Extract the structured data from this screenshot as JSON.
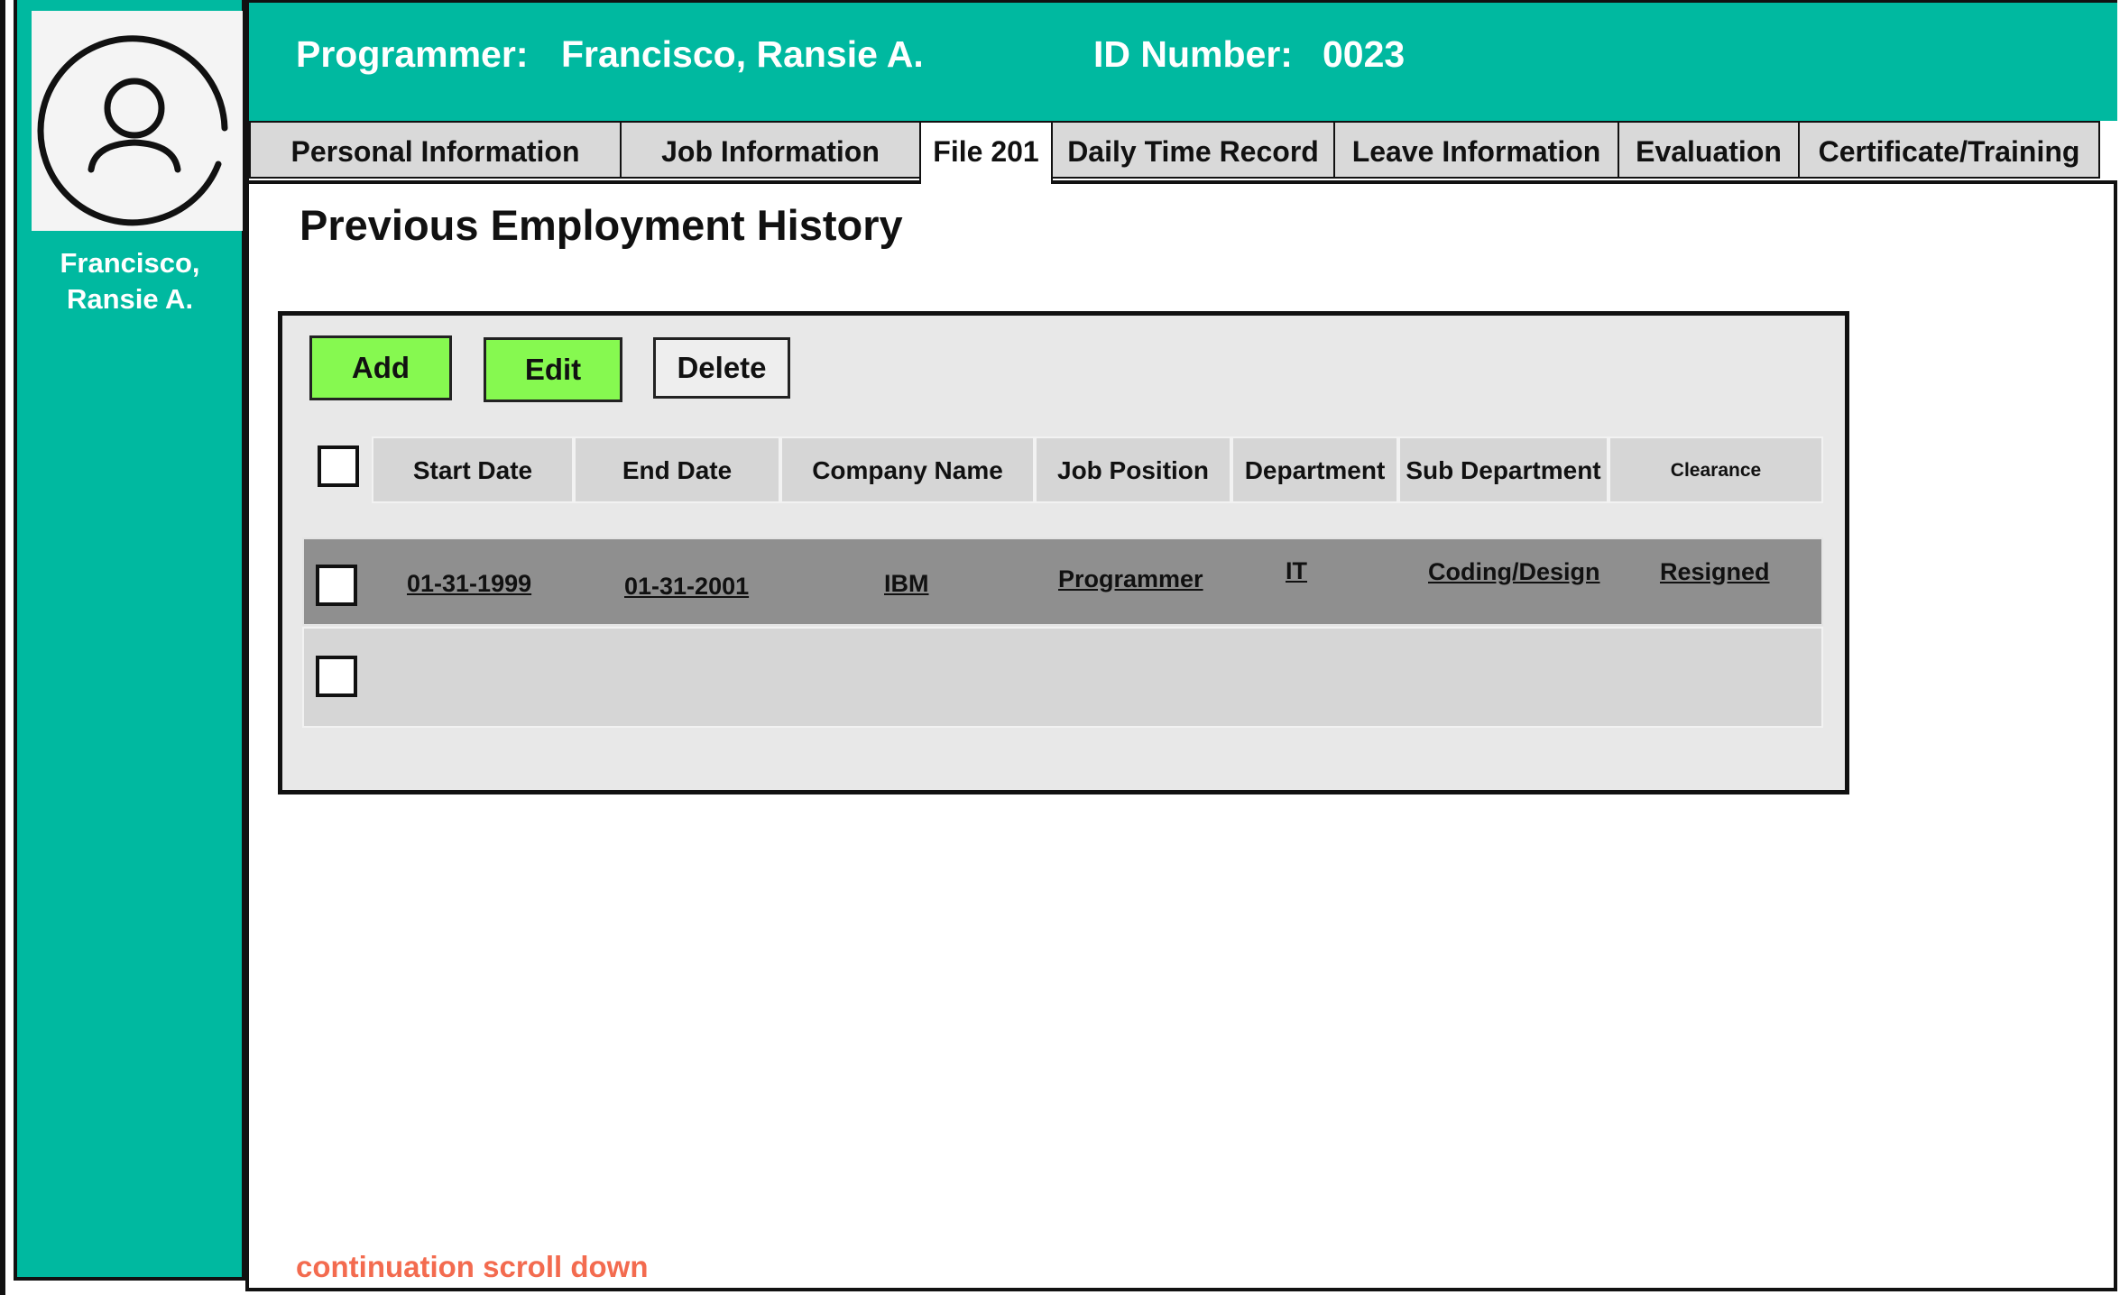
{
  "header": {
    "programmer_label": "Programmer:",
    "programmer_name": "Francisco, Ransie A.",
    "id_label": "ID Number:",
    "id_value": "0023"
  },
  "sidebar": {
    "name_line1": "Francisco,",
    "name_line2": "Ransie A.",
    "avatar_icon": "user-circle-icon"
  },
  "tabs": [
    {
      "label": "Personal Information",
      "active": false
    },
    {
      "label": "Job Information",
      "active": false
    },
    {
      "label": "File 201",
      "active": true
    },
    {
      "label": "Daily Time Record",
      "active": false
    },
    {
      "label": "Leave Information",
      "active": false
    },
    {
      "label": "Evaluation",
      "active": false
    },
    {
      "label": "Certificate/Training",
      "active": false
    }
  ],
  "page": {
    "title": "Previous Employment History",
    "footer_note": "continuation scroll down"
  },
  "toolbar": {
    "add_label": "Add",
    "edit_label": "Edit",
    "delete_label": "Delete"
  },
  "table": {
    "columns": [
      "Start Date",
      "End Date",
      "Company Name",
      "Job Position",
      "Department",
      "Sub Department",
      "Clearance"
    ],
    "rows": [
      {
        "start_date": "01-31-1999",
        "end_date": "01-31-2001",
        "company_name": "IBM",
        "job_position": "Programmer",
        "department": "IT",
        "sub_department": "Coding/Design",
        "clearance": "Resigned"
      }
    ]
  },
  "colors": {
    "accent": "#00b9a0",
    "button_green": "#86f950",
    "selected_row": "#8f8f8f",
    "footer_note": "#f36b4f"
  }
}
